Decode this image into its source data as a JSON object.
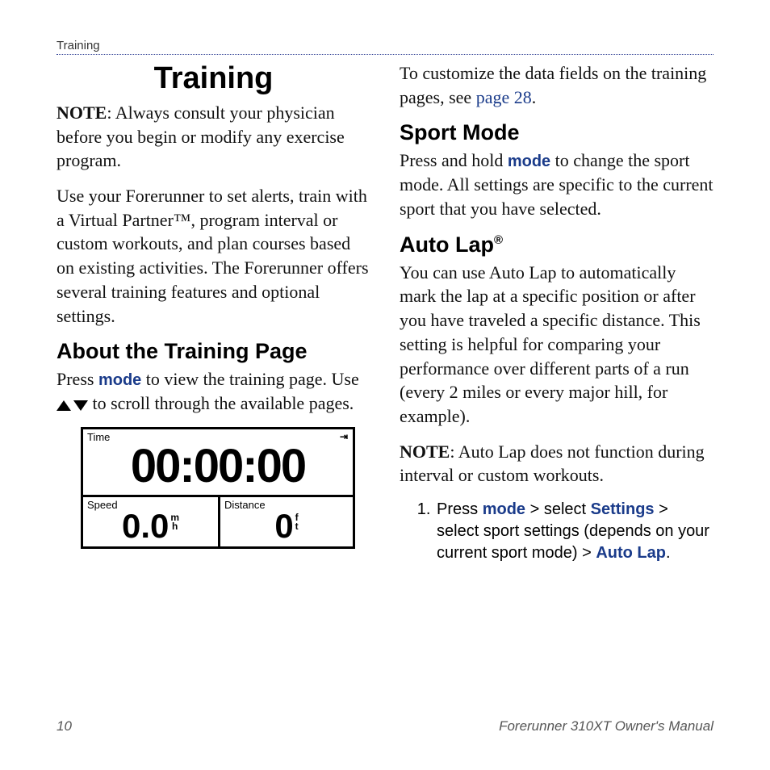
{
  "header": {
    "section": "Training"
  },
  "left": {
    "title": "Training",
    "note_label": "NOTE",
    "note_text": ": Always consult your physician before you begin or modify any exercise program.",
    "intro": "Use your Forerunner to set alerts, train with a Virtual Partner™, program interval or custom workouts, and plan courses based on existing activities. The Forerunner offers several training features and optional settings.",
    "about_h": "About the Training Page",
    "about_p1_a": "Press ",
    "about_mode": "mode",
    "about_p1_b": " to view the training page. Use ",
    "about_p1_c": " to scroll through the available pages."
  },
  "screen": {
    "time_label": "Time",
    "time_value": "00:00:00",
    "corner": "⇥",
    "speed_label": "Speed",
    "speed_value": "0.0",
    "speed_unit_top": "m",
    "speed_unit_bot": "h",
    "dist_label": "Distance",
    "dist_value": "0",
    "dist_unit_top": "f",
    "dist_unit_bot": "t"
  },
  "right": {
    "customize_a": "To customize the data fields on the training pages, see ",
    "customize_link": "page 28",
    "customize_b": ".",
    "sport_h": "Sport Mode",
    "sport_p_a": "Press and hold ",
    "sport_mode": "mode",
    "sport_p_b": " to change the sport mode. All settings are specific to the current sport that you have selected.",
    "autolap_h": "Auto Lap",
    "autolap_sup": "®",
    "autolap_p": "You can use Auto Lap to automatically mark the lap at a specific position or after you have traveled a specific distance. This setting is helpful for comparing your performance over different parts of a run (every 2 miles or every major hill, for example).",
    "autolap_note_label": "NOTE",
    "autolap_note": ": Auto Lap does not function during interval or custom workouts.",
    "step1_a": "Press ",
    "step1_mode": "mode",
    "step1_b": " > select ",
    "step1_settings": "Settings",
    "step1_c": " > select sport settings (depends on your current sport mode) > ",
    "step1_autolap": "Auto Lap",
    "step1_d": "."
  },
  "footer": {
    "page": "10",
    "manual": "Forerunner 310XT Owner's Manual"
  }
}
